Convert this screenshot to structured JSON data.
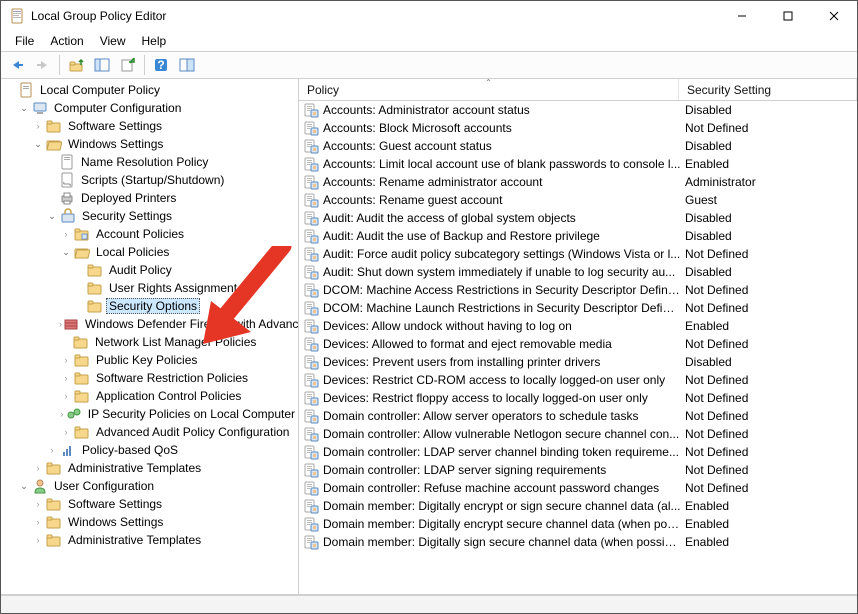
{
  "window": {
    "title": "Local Group Policy Editor"
  },
  "menu": [
    "File",
    "Action",
    "View",
    "Help"
  ],
  "tree": {
    "root": "Local Computer Policy",
    "computer_config": "Computer Configuration",
    "software_settings": "Software Settings",
    "windows_settings": "Windows Settings",
    "name_res": "Name Resolution Policy",
    "scripts": "Scripts (Startup/Shutdown)",
    "deployed_printers": "Deployed Printers",
    "security_settings": "Security Settings",
    "account_policies": "Account Policies",
    "local_policies": "Local Policies",
    "audit_policy": "Audit Policy",
    "user_rights": "User Rights Assignment",
    "security_options": "Security Options",
    "defender_fw": "Windows Defender Firewall with Advanced Security",
    "network_list": "Network List Manager Policies",
    "public_key": "Public Key Policies",
    "software_restrict": "Software Restriction Policies",
    "app_control": "Application Control Policies",
    "ip_sec": "IP Security Policies on Local Computer",
    "adv_audit": "Advanced Audit Policy Configuration",
    "policy_qos": "Policy-based QoS",
    "admin_templates": "Administrative Templates",
    "user_config": "User Configuration",
    "u_software": "Software Settings",
    "u_windows": "Windows Settings",
    "u_admin": "Administrative Templates"
  },
  "list": {
    "col1": "Policy",
    "col2": "Security Setting",
    "rows": [
      {
        "p": "Accounts: Administrator account status",
        "s": "Disabled"
      },
      {
        "p": "Accounts: Block Microsoft accounts",
        "s": "Not Defined"
      },
      {
        "p": "Accounts: Guest account status",
        "s": "Disabled"
      },
      {
        "p": "Accounts: Limit local account use of blank passwords to console l...",
        "s": "Enabled"
      },
      {
        "p": "Accounts: Rename administrator account",
        "s": "Administrator"
      },
      {
        "p": "Accounts: Rename guest account",
        "s": "Guest"
      },
      {
        "p": "Audit: Audit the access of global system objects",
        "s": "Disabled"
      },
      {
        "p": "Audit: Audit the use of Backup and Restore privilege",
        "s": "Disabled"
      },
      {
        "p": "Audit: Force audit policy subcategory settings (Windows Vista or l...",
        "s": "Not Defined"
      },
      {
        "p": "Audit: Shut down system immediately if unable to log security au...",
        "s": "Disabled"
      },
      {
        "p": "DCOM: Machine Access Restrictions in Security Descriptor Definiti...",
        "s": "Not Defined"
      },
      {
        "p": "DCOM: Machine Launch Restrictions in Security Descriptor Definit...",
        "s": "Not Defined"
      },
      {
        "p": "Devices: Allow undock without having to log on",
        "s": "Enabled"
      },
      {
        "p": "Devices: Allowed to format and eject removable media",
        "s": "Not Defined"
      },
      {
        "p": "Devices: Prevent users from installing printer drivers",
        "s": "Disabled"
      },
      {
        "p": "Devices: Restrict CD-ROM access to locally logged-on user only",
        "s": "Not Defined"
      },
      {
        "p": "Devices: Restrict floppy access to locally logged-on user only",
        "s": "Not Defined"
      },
      {
        "p": "Domain controller: Allow server operators to schedule tasks",
        "s": "Not Defined"
      },
      {
        "p": "Domain controller: Allow vulnerable Netlogon secure channel con...",
        "s": "Not Defined"
      },
      {
        "p": "Domain controller: LDAP server channel binding token requireme...",
        "s": "Not Defined"
      },
      {
        "p": "Domain controller: LDAP server signing requirements",
        "s": "Not Defined"
      },
      {
        "p": "Domain controller: Refuse machine account password changes",
        "s": "Not Defined"
      },
      {
        "p": "Domain member: Digitally encrypt or sign secure channel data (al...",
        "s": "Enabled"
      },
      {
        "p": "Domain member: Digitally encrypt secure channel data (when pos...",
        "s": "Enabled"
      },
      {
        "p": "Domain member: Digitally sign secure channel data (when possible)",
        "s": "Enabled"
      }
    ]
  }
}
